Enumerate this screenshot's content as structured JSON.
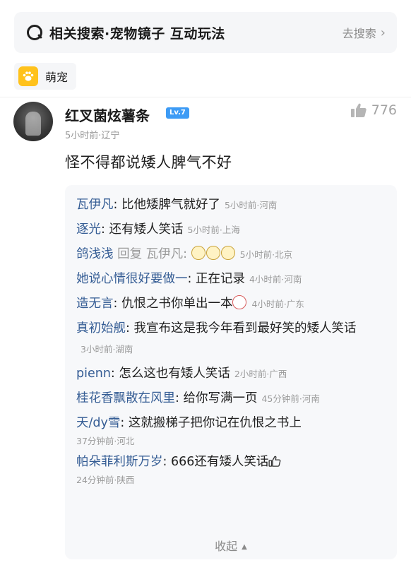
{
  "search": {
    "query": "相关搜索·宠物镜子 互动玩法",
    "action": "去搜索"
  },
  "tag": {
    "label": "萌宠"
  },
  "post": {
    "username": "红叉菌炫薯条",
    "level": "Lv.7",
    "likes": "776",
    "meta": "5小时前·辽宁",
    "content": "怪不得都说矮人脾气不好"
  },
  "replies": [
    {
      "user": "瓦伊凡",
      "text": "比他矮脾气就好了",
      "time": "5小时前·河南"
    },
    {
      "user": "逐光",
      "text": "还有矮人笑话",
      "time": "5小时前·上海"
    },
    {
      "user": "鸽浅浅",
      "reply_word": "回复",
      "reply_to": "瓦伊凡:",
      "text": "",
      "time": "5小时前·北京"
    },
    {
      "user": "她说心情很好要做一",
      "text": "正在记录",
      "time": "4小时前·河南"
    },
    {
      "user": "造无言",
      "text": "仇恨之书你单出一本",
      "time": "4小时前·广东"
    },
    {
      "user": "真初始舰",
      "text": "我宣布这是我今年看到最好笑的矮人笑话",
      "time": "3小时前·湖南"
    },
    {
      "user": "pienn",
      "text": "怎么这也有矮人笑话",
      "time": "2小时前·广西"
    },
    {
      "user": "桂花香飘散在风里",
      "text": "给你写满一页",
      "time": "45分钟前·河南"
    },
    {
      "user": "天/dy雪",
      "text": "这就搬梯子把你记在仇恨之书上",
      "time": "37分钟前·河北"
    },
    {
      "user": "帕朵菲利斯万岁",
      "text": "666还有矮人笑话",
      "time": "24分钟前·陕西"
    }
  ],
  "collapse_label": "收起"
}
